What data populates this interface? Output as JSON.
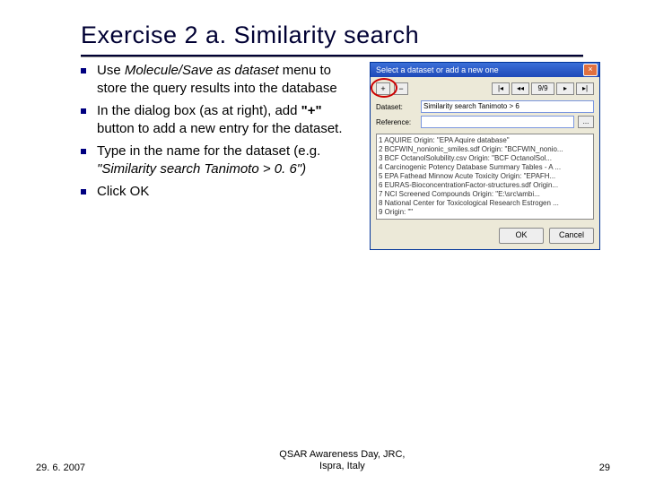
{
  "title": "Exercise 2 a. Similarity search",
  "bullets": {
    "b1a": "Use ",
    "b1i": "Molecule/Save as dataset",
    "b1b": " menu to store the query results into the database",
    "b2a": "In the dialog box (as at right), add ",
    "b2q": "\"+\"",
    "b2b": " button to add a new entry for the dataset.",
    "b3": "Type in the name for the dataset (e.g. ",
    "b3i": "\"Similarity search Tanimoto > 0. 6\")",
    "b4": "Click OK"
  },
  "dialog": {
    "title": "Select a dataset or add a new one",
    "plus": "+",
    "minus": "−",
    "nav": {
      "first": "|◂",
      "prev": "◂◂",
      "pos": "9/9",
      "next": "▸",
      "last": "▸|"
    },
    "labels": {
      "dataset": "Dataset:",
      "reference": "Reference:"
    },
    "datasetValue": "Similarity search Tanimoto > 6",
    "browse": "...",
    "list": [
      "1 AQUIRE Origin: \"EPA Aquire database\"",
      "2 BCFWIN_nonionic_smiles.sdf Origin: \"BCFWIN_nonio...",
      "3 BCF OctanolSolubility.csv Origin: \"BCF OctanolSol...",
      "4 Carcinogenic Potency Database Summary Tables - A ...",
      "5 EPA Fathead Minnow Acute Toxicity Origin: \"EPAFH...",
      "6 EURAS-BioconcentrationFactor-structures.sdf Origin...",
      "7 NCI Screened Compounds Origin: \"E:\\src\\ambi...",
      "8 National Center for Toxicological Research Estrogen ...",
      "9 Origin: \"\""
    ],
    "ok": "OK",
    "cancel": "Cancel"
  },
  "footer": {
    "date": "29. 6. 2007",
    "venue1": "QSAR Awareness Day, JRC,",
    "venue2": "Ispra, Italy",
    "pageno": "29"
  }
}
